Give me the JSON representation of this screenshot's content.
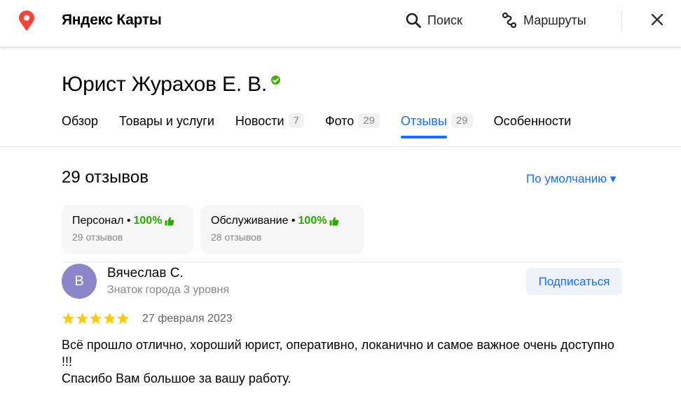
{
  "header": {
    "brand": "Яндекс Карты",
    "search_label": "Поиск",
    "routes_label": "Маршруты",
    "pin_color": "#ff4433"
  },
  "org": {
    "title": "Юрист Журахов Е. В.",
    "verified_color": "#3bb300"
  },
  "tabs": [
    {
      "label": "Обзор",
      "count": ""
    },
    {
      "label": "Товары и услуги",
      "count": ""
    },
    {
      "label": "Новости",
      "count": "7"
    },
    {
      "label": "Фото",
      "count": "29"
    },
    {
      "label": "Отзывы",
      "count": "29",
      "active": true
    },
    {
      "label": "Особенности",
      "count": ""
    }
  ],
  "reviews_section": {
    "count_label": "29 отзывов",
    "sort_label": "По умолчанию ▾",
    "aspects": [
      {
        "name": "Персонал",
        "percent": "100%",
        "sub": "29 отзывов"
      },
      {
        "name": "Обслуживание",
        "percent": "100%",
        "sub": "28 отзывов"
      }
    ]
  },
  "review": {
    "avatar_letter": "В",
    "author": "Вячеслав С.",
    "level": "Знаток города 3 уровня",
    "subscribe_label": "Подписаться",
    "rating": 5,
    "date": "27 февраля 2023",
    "text_line1": "Всё прошло отлично, хороший юрист, оперативно, локанично и самое важное очень доступно !!!",
    "text_line2": "Спасибо Вам большое за вашу работу."
  },
  "colors": {
    "accent": "#196dff",
    "positive": "#2ba900",
    "star": "#fc0"
  }
}
